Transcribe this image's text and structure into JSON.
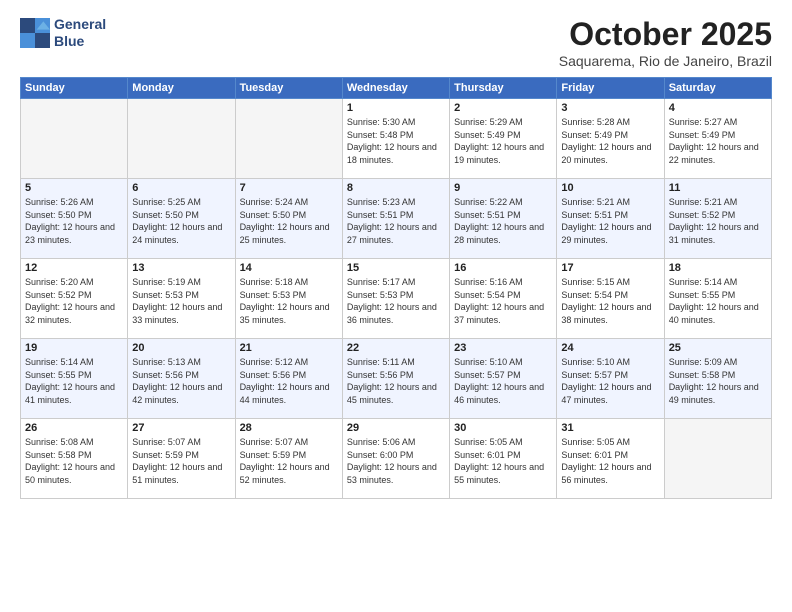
{
  "header": {
    "logo_line1": "General",
    "logo_line2": "Blue",
    "month": "October 2025",
    "location": "Saquarema, Rio de Janeiro, Brazil"
  },
  "days_of_week": [
    "Sunday",
    "Monday",
    "Tuesday",
    "Wednesday",
    "Thursday",
    "Friday",
    "Saturday"
  ],
  "weeks": [
    [
      {
        "day": "",
        "info": ""
      },
      {
        "day": "",
        "info": ""
      },
      {
        "day": "",
        "info": ""
      },
      {
        "day": "1",
        "info": "Sunrise: 5:30 AM\nSunset: 5:48 PM\nDaylight: 12 hours\nand 18 minutes."
      },
      {
        "day": "2",
        "info": "Sunrise: 5:29 AM\nSunset: 5:49 PM\nDaylight: 12 hours\nand 19 minutes."
      },
      {
        "day": "3",
        "info": "Sunrise: 5:28 AM\nSunset: 5:49 PM\nDaylight: 12 hours\nand 20 minutes."
      },
      {
        "day": "4",
        "info": "Sunrise: 5:27 AM\nSunset: 5:49 PM\nDaylight: 12 hours\nand 22 minutes."
      }
    ],
    [
      {
        "day": "5",
        "info": "Sunrise: 5:26 AM\nSunset: 5:50 PM\nDaylight: 12 hours\nand 23 minutes."
      },
      {
        "day": "6",
        "info": "Sunrise: 5:25 AM\nSunset: 5:50 PM\nDaylight: 12 hours\nand 24 minutes."
      },
      {
        "day": "7",
        "info": "Sunrise: 5:24 AM\nSunset: 5:50 PM\nDaylight: 12 hours\nand 25 minutes."
      },
      {
        "day": "8",
        "info": "Sunrise: 5:23 AM\nSunset: 5:51 PM\nDaylight: 12 hours\nand 27 minutes."
      },
      {
        "day": "9",
        "info": "Sunrise: 5:22 AM\nSunset: 5:51 PM\nDaylight: 12 hours\nand 28 minutes."
      },
      {
        "day": "10",
        "info": "Sunrise: 5:21 AM\nSunset: 5:51 PM\nDaylight: 12 hours\nand 29 minutes."
      },
      {
        "day": "11",
        "info": "Sunrise: 5:21 AM\nSunset: 5:52 PM\nDaylight: 12 hours\nand 31 minutes."
      }
    ],
    [
      {
        "day": "12",
        "info": "Sunrise: 5:20 AM\nSunset: 5:52 PM\nDaylight: 12 hours\nand 32 minutes."
      },
      {
        "day": "13",
        "info": "Sunrise: 5:19 AM\nSunset: 5:53 PM\nDaylight: 12 hours\nand 33 minutes."
      },
      {
        "day": "14",
        "info": "Sunrise: 5:18 AM\nSunset: 5:53 PM\nDaylight: 12 hours\nand 35 minutes."
      },
      {
        "day": "15",
        "info": "Sunrise: 5:17 AM\nSunset: 5:53 PM\nDaylight: 12 hours\nand 36 minutes."
      },
      {
        "day": "16",
        "info": "Sunrise: 5:16 AM\nSunset: 5:54 PM\nDaylight: 12 hours\nand 37 minutes."
      },
      {
        "day": "17",
        "info": "Sunrise: 5:15 AM\nSunset: 5:54 PM\nDaylight: 12 hours\nand 38 minutes."
      },
      {
        "day": "18",
        "info": "Sunrise: 5:14 AM\nSunset: 5:55 PM\nDaylight: 12 hours\nand 40 minutes."
      }
    ],
    [
      {
        "day": "19",
        "info": "Sunrise: 5:14 AM\nSunset: 5:55 PM\nDaylight: 12 hours\nand 41 minutes."
      },
      {
        "day": "20",
        "info": "Sunrise: 5:13 AM\nSunset: 5:56 PM\nDaylight: 12 hours\nand 42 minutes."
      },
      {
        "day": "21",
        "info": "Sunrise: 5:12 AM\nSunset: 5:56 PM\nDaylight: 12 hours\nand 44 minutes."
      },
      {
        "day": "22",
        "info": "Sunrise: 5:11 AM\nSunset: 5:56 PM\nDaylight: 12 hours\nand 45 minutes."
      },
      {
        "day": "23",
        "info": "Sunrise: 5:10 AM\nSunset: 5:57 PM\nDaylight: 12 hours\nand 46 minutes."
      },
      {
        "day": "24",
        "info": "Sunrise: 5:10 AM\nSunset: 5:57 PM\nDaylight: 12 hours\nand 47 minutes."
      },
      {
        "day": "25",
        "info": "Sunrise: 5:09 AM\nSunset: 5:58 PM\nDaylight: 12 hours\nand 49 minutes."
      }
    ],
    [
      {
        "day": "26",
        "info": "Sunrise: 5:08 AM\nSunset: 5:58 PM\nDaylight: 12 hours\nand 50 minutes."
      },
      {
        "day": "27",
        "info": "Sunrise: 5:07 AM\nSunset: 5:59 PM\nDaylight: 12 hours\nand 51 minutes."
      },
      {
        "day": "28",
        "info": "Sunrise: 5:07 AM\nSunset: 5:59 PM\nDaylight: 12 hours\nand 52 minutes."
      },
      {
        "day": "29",
        "info": "Sunrise: 5:06 AM\nSunset: 6:00 PM\nDaylight: 12 hours\nand 53 minutes."
      },
      {
        "day": "30",
        "info": "Sunrise: 5:05 AM\nSunset: 6:01 PM\nDaylight: 12 hours\nand 55 minutes."
      },
      {
        "day": "31",
        "info": "Sunrise: 5:05 AM\nSunset: 6:01 PM\nDaylight: 12 hours\nand 56 minutes."
      },
      {
        "day": "",
        "info": ""
      }
    ]
  ]
}
